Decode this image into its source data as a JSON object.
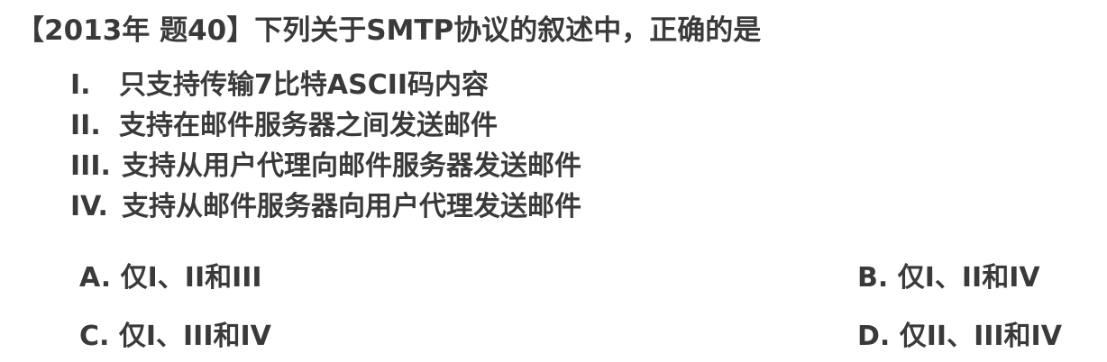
{
  "question": {
    "title": "【2013年 题40】下列关于SMTP协议的叙述中，正确的是"
  },
  "statements": [
    {
      "num": "I.",
      "text": "只支持传输7比特ASCII码内容"
    },
    {
      "num": "II.",
      "text": "支持在邮件服务器之间发送邮件"
    },
    {
      "num": "III.",
      "text": "支持从用户代理向邮件服务器发送邮件"
    },
    {
      "num": "IV.",
      "text": "支持从邮件服务器向用户代理发送邮件"
    }
  ],
  "options": {
    "a": "A. 仅I、II和III",
    "b": "B. 仅I、II和IV",
    "c": "C. 仅I、III和IV",
    "d": "D. 仅II、III和IV"
  }
}
